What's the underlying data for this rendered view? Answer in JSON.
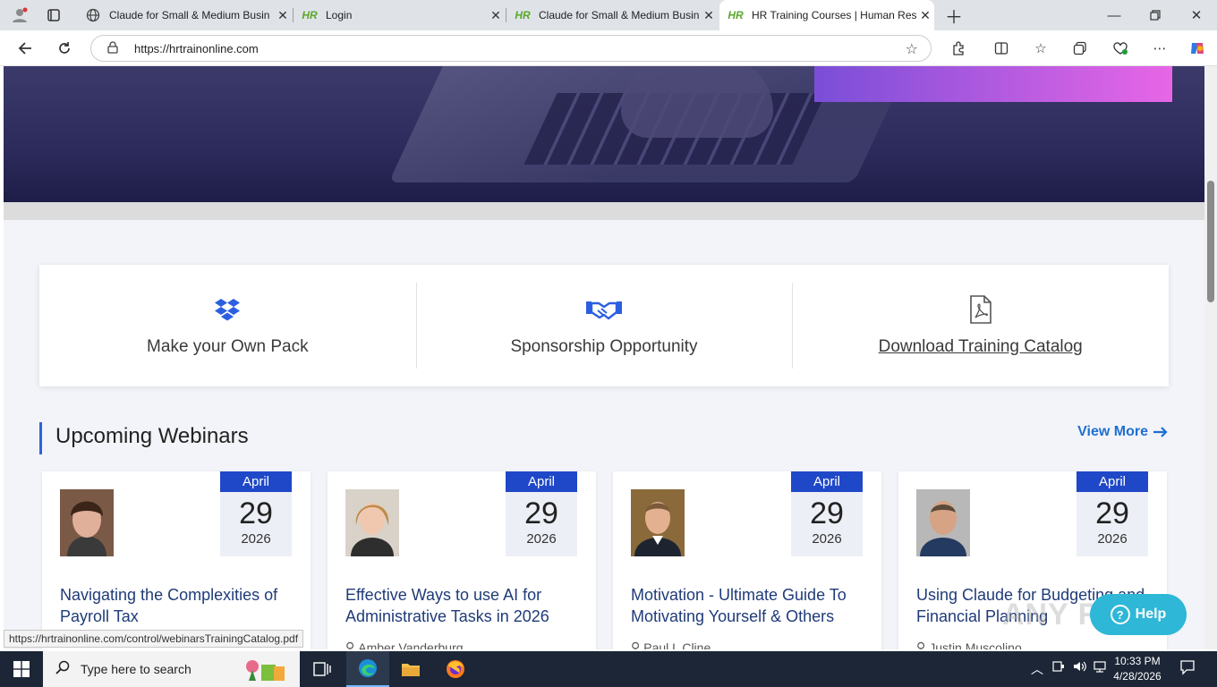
{
  "browser": {
    "tabs": [
      {
        "title": "Claude for Small & Medium Busin",
        "favicon": "globe-icon"
      },
      {
        "title": "Login",
        "favicon": "HR"
      },
      {
        "title": "Claude for Small & Medium Busin",
        "favicon": "HR"
      },
      {
        "title": "HR Training Courses | Human Res",
        "favicon": "HR",
        "active": true
      }
    ],
    "url": "https://hrtrainonline.com",
    "status_url": "https://hrtrainonline.com/control/webinarsTrainingCatalog.pdf"
  },
  "features": [
    {
      "label": "Make your Own Pack",
      "icon": "dropbox-icon"
    },
    {
      "label": "Sponsorship Opportunity",
      "icon": "handshake-icon"
    },
    {
      "label": "Download Training Catalog",
      "icon": "pdf-icon"
    }
  ],
  "webinars": {
    "heading": "Upcoming Webinars",
    "view_more": "View More",
    "cards": [
      {
        "month": "April",
        "day": "29",
        "year": "2026",
        "title": "Navigating the Complexities of Payroll Tax",
        "author": ""
      },
      {
        "month": "April",
        "day": "29",
        "year": "2026",
        "title": "Effective Ways to use AI for Administrative Tasks in 2026",
        "author": "Amber Vanderburg"
      },
      {
        "month": "April",
        "day": "29",
        "year": "2026",
        "title": "Motivation - Ultimate Guide To Motivating Yourself & Others",
        "author": "Paul L Cline"
      },
      {
        "month": "April",
        "day": "29",
        "year": "2026",
        "title": "Using Claude for Budgeting and Financial Planning",
        "author": "Justin Muscolino"
      }
    ]
  },
  "help": {
    "label": "Help"
  },
  "watermark": "ANY RUN",
  "taskbar": {
    "search_placeholder": "Type here to search",
    "time": "10:33 PM",
    "date": "4/28/2026"
  },
  "colors": {
    "accent": "#1f48c8",
    "link": "#1f6fd1",
    "card_title": "#1f3b78",
    "help": "#2eb7d6"
  }
}
